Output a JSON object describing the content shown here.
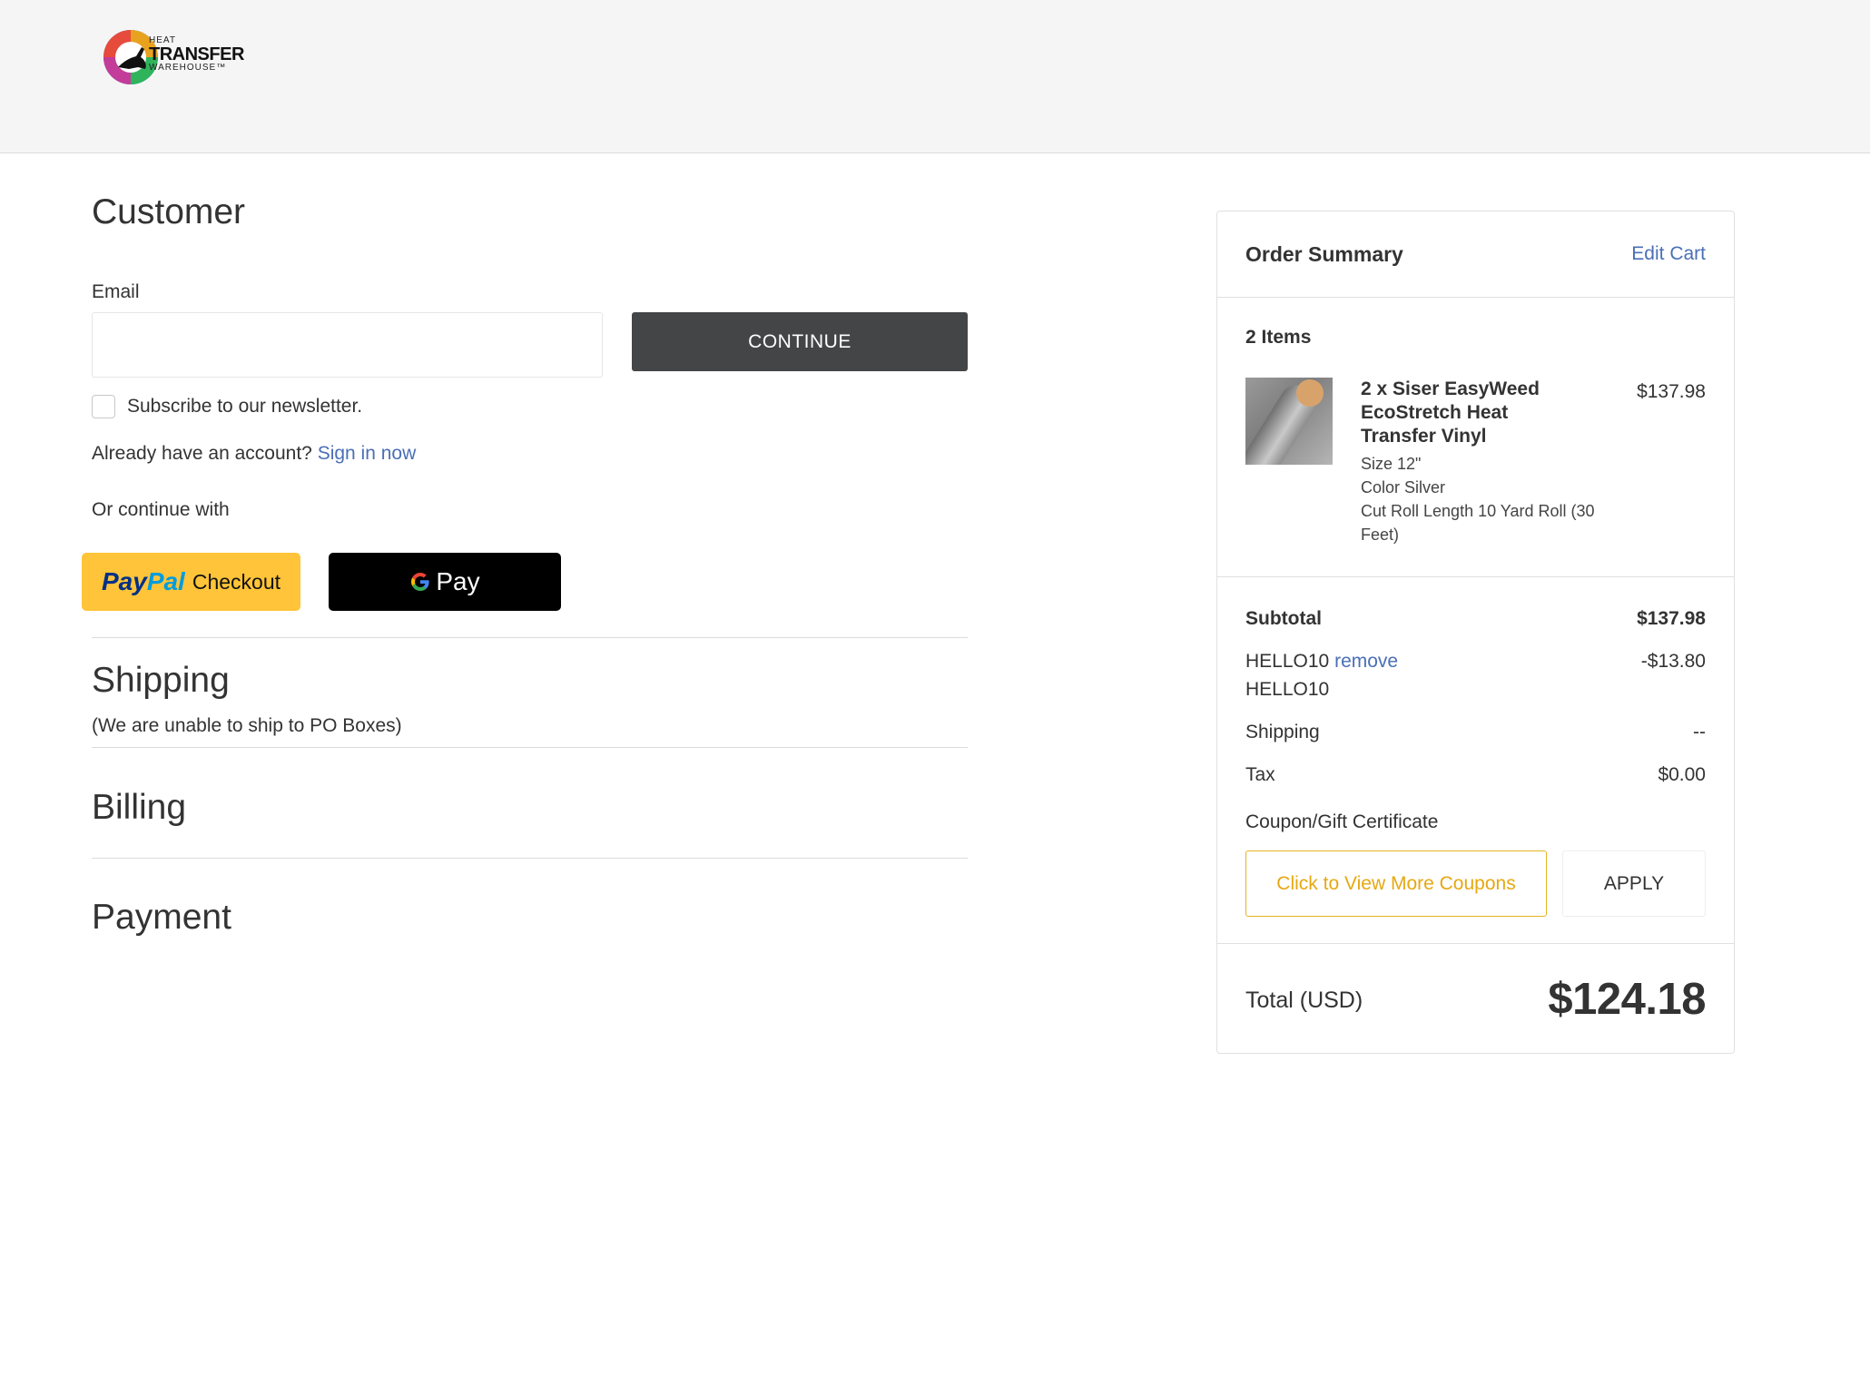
{
  "header": {
    "logo_line1": "HEAT",
    "logo_line2": "TRANSFER",
    "logo_line3": "WAREHOUSE™"
  },
  "customer": {
    "title": "Customer",
    "email_label": "Email",
    "email_value": "",
    "continue_label": "CONTINUE",
    "newsletter_label": "Subscribe to our newsletter.",
    "newsletter_checked": false,
    "account_prompt": "Already have an account?",
    "sign_in_label": "Sign in now",
    "or_continue": "Or continue with",
    "paypal_pay": "Pay",
    "paypal_pal": "Pal",
    "paypal_checkout": "Checkout",
    "gpay_label": "Pay"
  },
  "shipping": {
    "title": "Shipping",
    "note": "(We are unable to ship to PO Boxes)"
  },
  "billing": {
    "title": "Billing"
  },
  "payment": {
    "title": "Payment"
  },
  "summary": {
    "title": "Order Summary",
    "edit_cart": "Edit Cart",
    "items_count": "2 Items",
    "item": {
      "name": "2 x Siser EasyWeed EcoStretch Heat Transfer Vinyl",
      "price": "$137.98",
      "option_size": "Size 12\"",
      "option_color": "Color Silver",
      "option_length": "Cut Roll Length 10 Yard Roll (30 Feet)"
    },
    "subtotal_label": "Subtotal",
    "subtotal_value": "$137.98",
    "coupon_code": "HELLO10",
    "coupon_remove": "remove",
    "coupon_code_line2": "HELLO10",
    "coupon_discount": "-$13.80",
    "shipping_label": "Shipping",
    "shipping_value": "--",
    "tax_label": "Tax",
    "tax_value": "$0.00",
    "coupon_field_label": "Coupon/Gift Certificate",
    "view_coupons": "Click to View More Coupons",
    "apply_label": "APPLY",
    "total_label": "Total (USD)",
    "total_value": "$124.18"
  },
  "colors": {
    "link": "#4a6fb5",
    "continue_button": "#444546",
    "paypal_yellow": "#ffc439",
    "coupon_gold": "#e6a812"
  }
}
